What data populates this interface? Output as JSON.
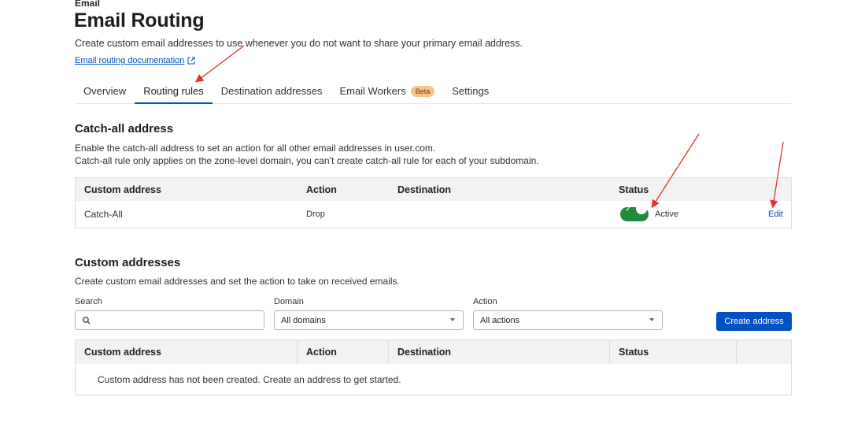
{
  "header": {
    "eyebrow": "Email",
    "title": "Email Routing",
    "subtitle": "Create custom email addresses to use whenever you do not want to share your primary email address.",
    "doc_link": "Email routing documentation"
  },
  "tabs": [
    {
      "label": "Overview",
      "active": false
    },
    {
      "label": "Routing rules",
      "active": true
    },
    {
      "label": "Destination addresses",
      "active": false
    },
    {
      "label": "Email Workers",
      "active": false,
      "badge": "Beta"
    },
    {
      "label": "Settings",
      "active": false
    }
  ],
  "catch_all": {
    "title": "Catch-all address",
    "desc_line1": "Enable the catch-all address to set an action for all other email addresses in user.com.",
    "desc_line2": "Catch-all rule only applies on the zone-level domain, you can’t create catch-all rule for each of your subdomain.",
    "columns": [
      "Custom address",
      "Action",
      "Destination",
      "Status"
    ],
    "row": {
      "address": "Catch-All",
      "action": "Drop",
      "destination": "",
      "status": "Active",
      "enabled": true,
      "edit_label": "Edit"
    }
  },
  "custom": {
    "title": "Custom addresses",
    "desc": "Create custom email addresses and set the action to take on received emails.",
    "search_label": "Search",
    "search_value": "",
    "domain_label": "Domain",
    "domain_value": "All domains",
    "action_label": "Action",
    "action_value": "All actions",
    "create_button": "Create address",
    "columns": [
      "Custom address",
      "Action",
      "Destination",
      "Status",
      ""
    ],
    "empty_message": "Custom address has not been created. Create an address to get started."
  },
  "colors": {
    "accent": "#0051c3",
    "toggle_on": "#1e8b3b",
    "annotation_arrow": "#e5322d",
    "beta_badge": "#f6c38c"
  }
}
